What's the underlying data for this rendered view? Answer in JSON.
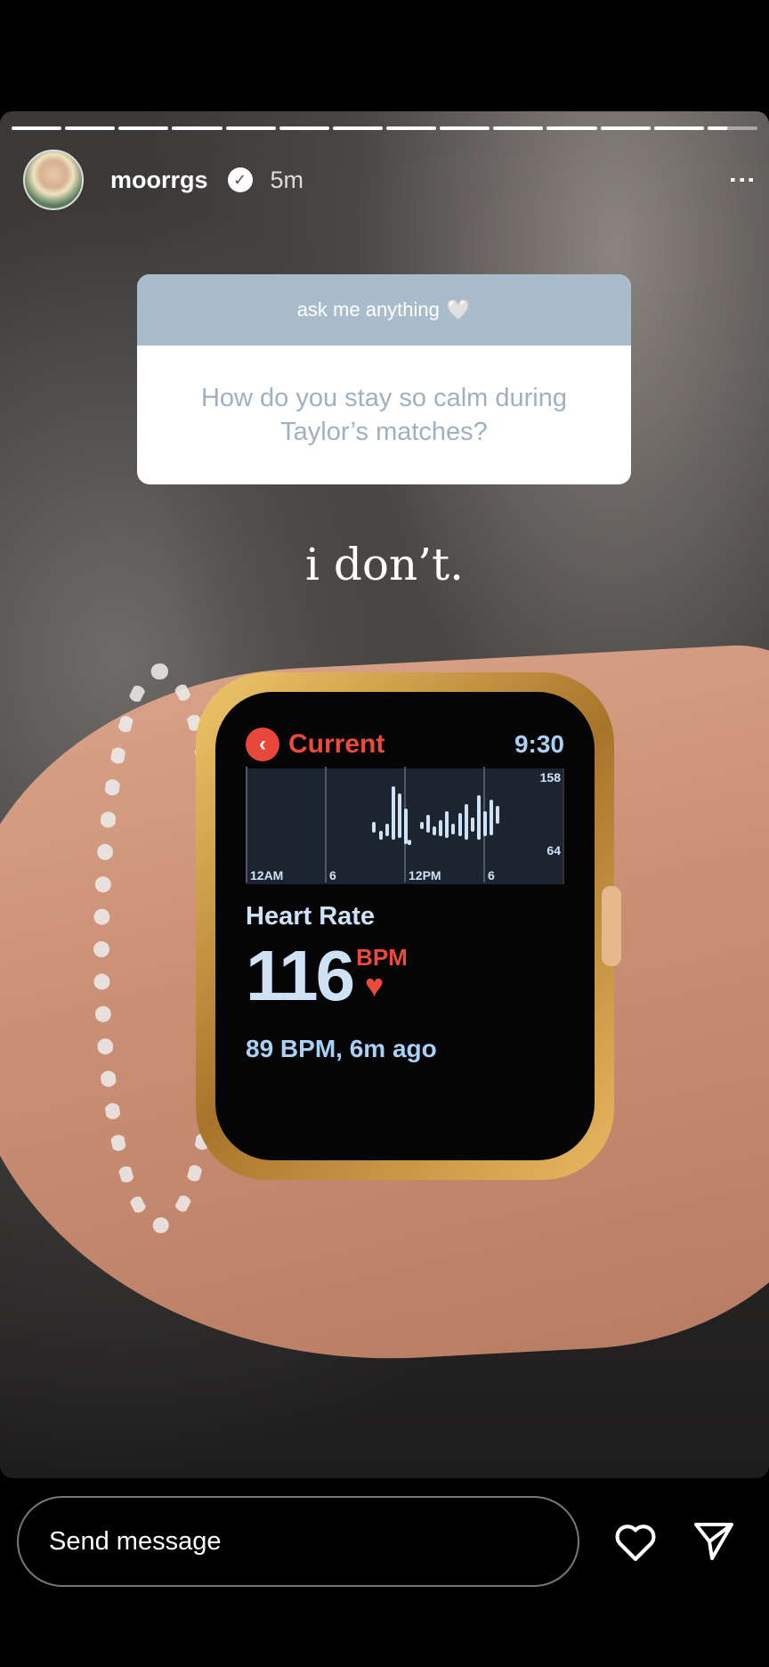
{
  "story": {
    "segments_total": 14,
    "current_segment": 14,
    "current_progress": 0.4
  },
  "header": {
    "username": "moorrgs",
    "verified": true,
    "verified_icon": "✓",
    "time": "5m",
    "more_icon": "⋮"
  },
  "question": {
    "title": "ask me anything",
    "title_emoji": "🤍",
    "text": "How do you stay so calm during Taylor’s matches?"
  },
  "answer": "i don’t.",
  "watch": {
    "back_icon": "‹",
    "title": "Current",
    "clock": "9:30",
    "chart": {
      "x_labels": [
        "12AM",
        "6",
        "12PM",
        "6"
      ],
      "y_max_label": "158",
      "y_min_label": "64"
    },
    "hr_label": "Heart Rate",
    "hr_value": "116",
    "hr_unit": "BPM",
    "heart_icon": "♥",
    "last_reading": "89 BPM, 6m ago"
  },
  "footer": {
    "message_placeholder": "Send message"
  },
  "colors": {
    "question_header": "#a9bccb",
    "watch_accent": "#ea4b3c",
    "watch_text": "#a9d0f5"
  }
}
